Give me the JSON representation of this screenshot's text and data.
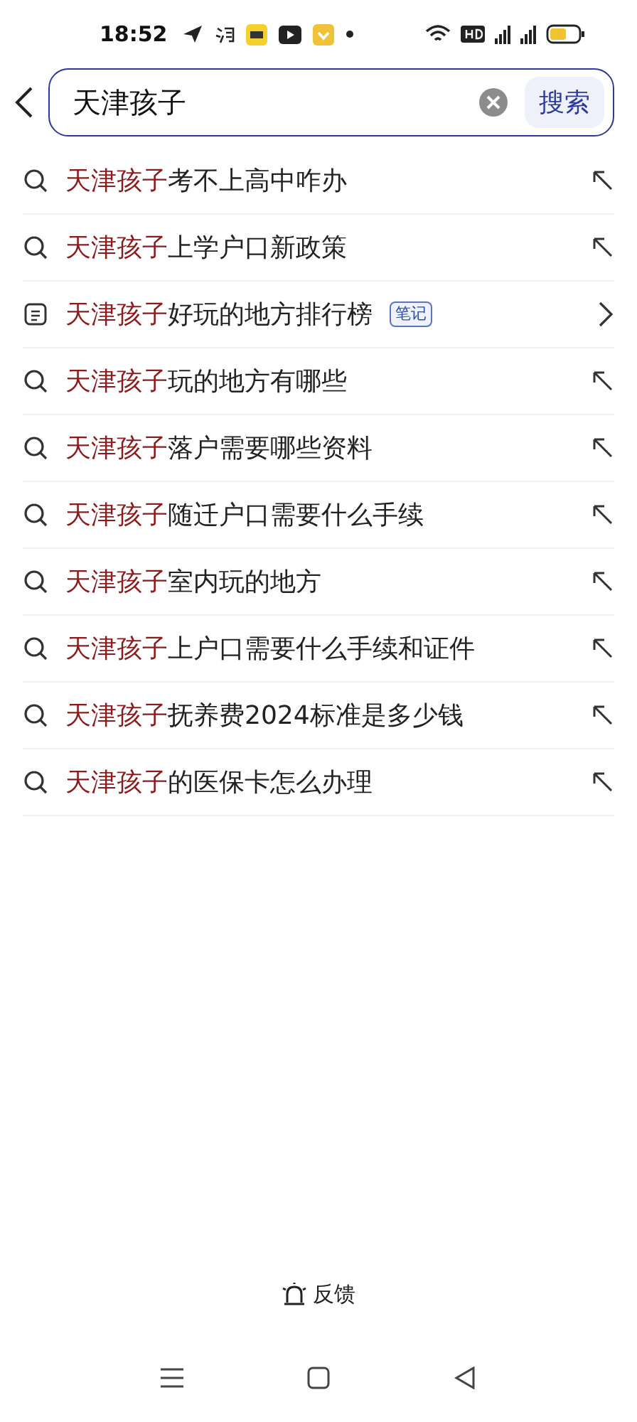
{
  "status_bar": {
    "time": "18:52"
  },
  "search": {
    "value": "天津孩子",
    "button": "搜索"
  },
  "suggestions": [
    {
      "kind": "search",
      "highlight": "天津孩子",
      "text": "考不上高中咋办"
    },
    {
      "kind": "search",
      "highlight": "天津孩子",
      "text": "上学户口新政策"
    },
    {
      "kind": "note",
      "highlight": "天津孩子",
      "text": "好玩的地方排行榜",
      "badge": "笔记"
    },
    {
      "kind": "search",
      "highlight": "天津孩子",
      "text": "玩的地方有哪些"
    },
    {
      "kind": "search",
      "highlight": "天津孩子",
      "text": "落户需要哪些资料"
    },
    {
      "kind": "search",
      "highlight": "天津孩子",
      "text": "随迁户口需要什么手续"
    },
    {
      "kind": "search",
      "highlight": "天津孩子",
      "text": "室内玩的地方"
    },
    {
      "kind": "search",
      "highlight": "天津孩子",
      "text": "上户口需要什么手续和证件"
    },
    {
      "kind": "search",
      "highlight": "天津孩子",
      "text": "抚养费2024标准是多少钱"
    },
    {
      "kind": "search",
      "highlight": "天津孩子",
      "text": "的医保卡怎么办理"
    }
  ],
  "feedback": "反馈"
}
